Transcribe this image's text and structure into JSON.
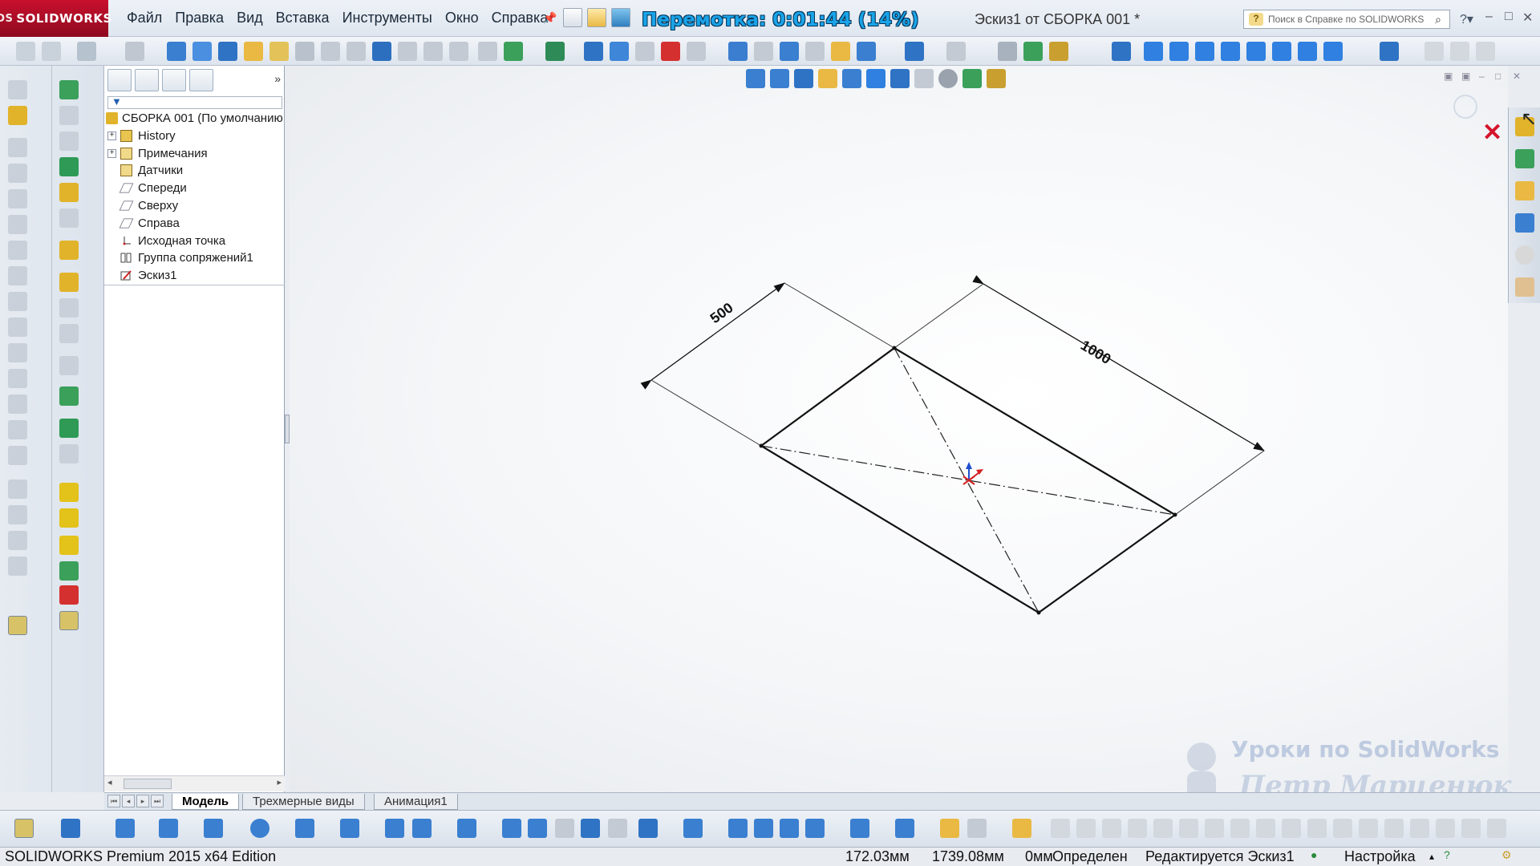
{
  "app": {
    "logo_text": "SOLIDWORKS",
    "document_title": "Эскиз1 от СБОРКА 001 *",
    "overlay_label": "Перемотка: 0:01:44 (14%)"
  },
  "menu": [
    "Файл",
    "Правка",
    "Вид",
    "Вставка",
    "Инструменты",
    "Окно",
    "Справка"
  ],
  "search": {
    "placeholder": "Поиск в Справке по SOLIDWORKS"
  },
  "feature_tree": {
    "root": "СБОРКА 001  (По умолчанию",
    "items": [
      {
        "label": "History",
        "expandable": true,
        "icon": "history-icon"
      },
      {
        "label": "Примечания",
        "expandable": true,
        "icon": "annotations-icon"
      },
      {
        "label": "Датчики",
        "expandable": false,
        "icon": "sensors-icon"
      },
      {
        "label": "Спереди",
        "expandable": false,
        "icon": "plane-icon"
      },
      {
        "label": "Сверху",
        "expandable": false,
        "icon": "plane-icon"
      },
      {
        "label": "Справа",
        "expandable": false,
        "icon": "plane-icon"
      },
      {
        "label": "Исходная точка",
        "expandable": false,
        "icon": "origin-icon"
      },
      {
        "label": "Группа сопряжений1",
        "expandable": false,
        "icon": "mates-icon"
      },
      {
        "label": "Эскиз1",
        "expandable": false,
        "icon": "sketch-icon"
      }
    ]
  },
  "sketch": {
    "dimension_short": "500",
    "dimension_long": "1000"
  },
  "bottom_tabs": [
    "Модель",
    "Трехмерные виды",
    "Анимация1"
  ],
  "status": {
    "edition": "SOLIDWORKS Premium 2015 x64 Edition",
    "x": "172.03мм",
    "y": "1739.08мм",
    "z": "0мм",
    "state": "Определен",
    "editing": "Редактируется Эскиз1",
    "settings": "Настройка"
  },
  "watermark": {
    "line1": "Уроки по SolidWorks",
    "line2": "Петр Марценюк"
  },
  "colors": {
    "brand_red": "#c8102e",
    "overlay_blue": "#1aa3e8",
    "close_red": "#d4142b"
  }
}
